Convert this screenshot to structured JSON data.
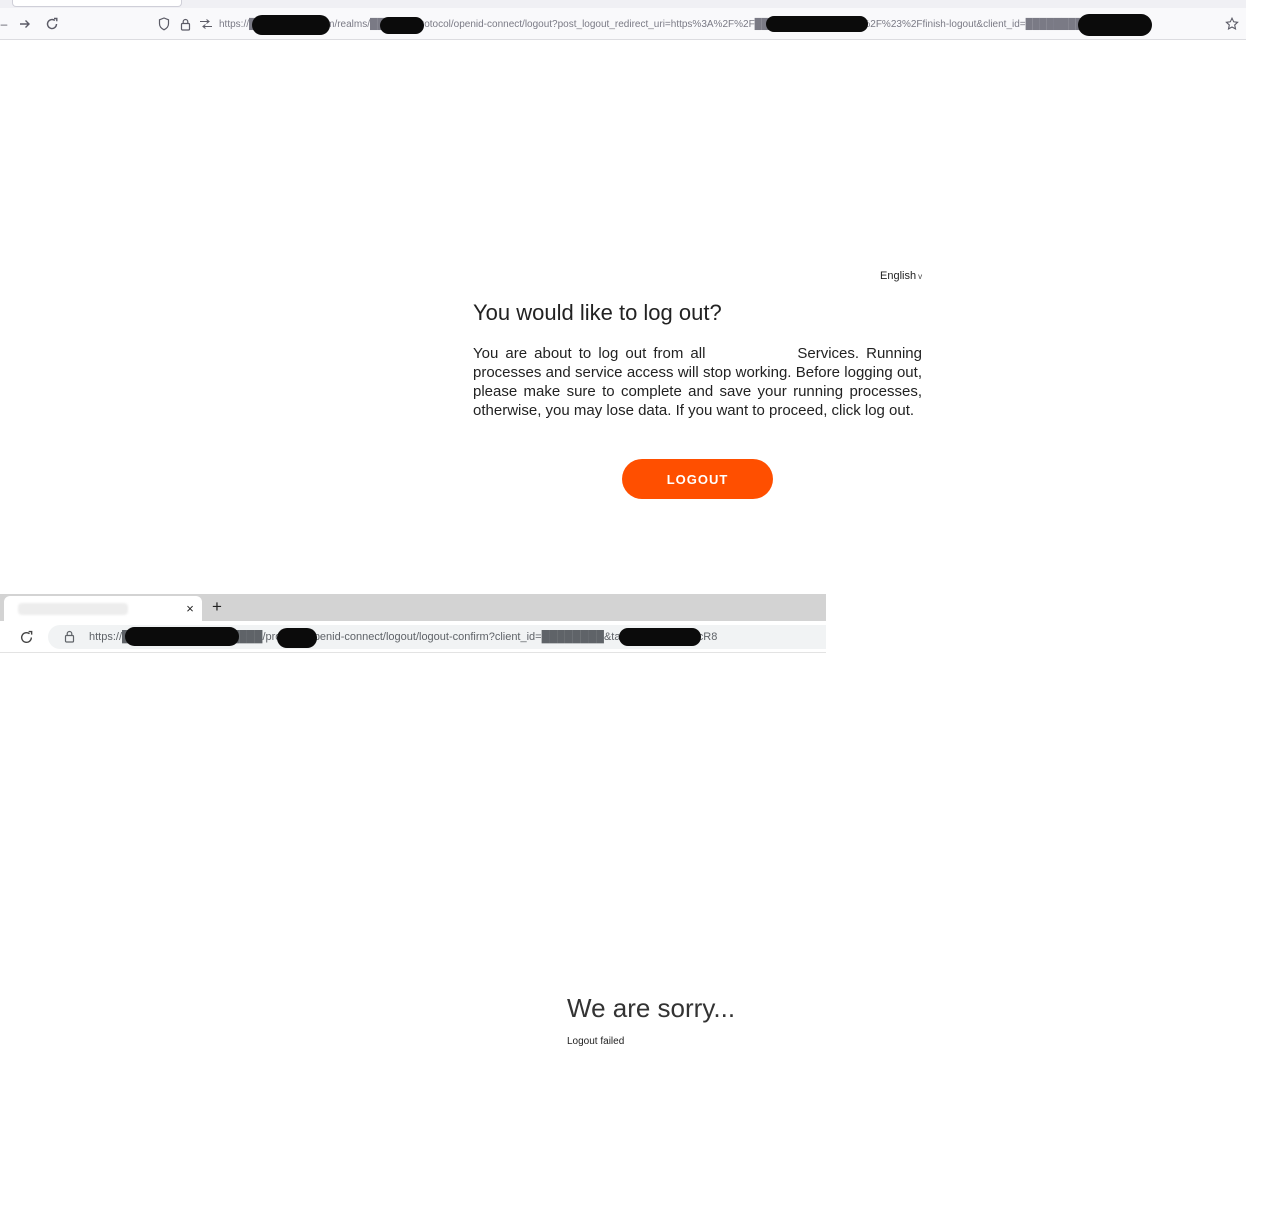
{
  "browser_top": {
    "url": "https://█████████.com/realms/██████/protocol/openid-connect/logout?post_logout_redirect_uri=https%3A%2F%2F████████████.com%2F%23%2Ffinish-logout&client_id=████████&ui_locales=en"
  },
  "logout_page": {
    "language": "English",
    "title": "You would like to log out?",
    "text": "You are about to log out from all             Services. Running processes and service access will stop working. Before logging out, please make sure to complete and save your running processes, otherwise, you may lose data. If you want to proceed, click log out.",
    "button_label": "LOGOUT",
    "button_color": "#ff4f00"
  },
  "browser_bottom": {
    "url": "https://█████████/realms/████/protocol/openid-connect/logout/logout-confirm?client_id=████████&tab_id=ILR-PVSAcR8",
    "close_glyph": "×",
    "newtab_glyph": "+"
  },
  "error_page": {
    "title": "We are sorry...",
    "message": "Logout failed"
  }
}
